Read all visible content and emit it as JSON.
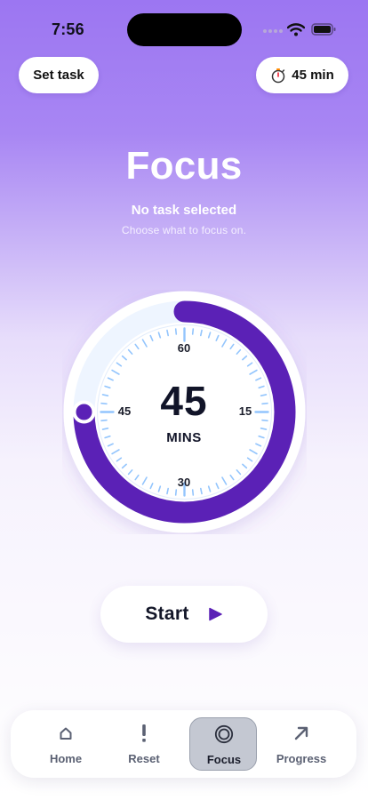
{
  "status_bar": {
    "time": "7:56"
  },
  "header": {
    "set_task_label": "Set task",
    "duration_label": "45 min",
    "duration_icon": "stopwatch-icon"
  },
  "focus": {
    "title": "Focus",
    "task_status": "No task selected",
    "hint": "Choose what to focus on."
  },
  "dial": {
    "value": "45",
    "unit": "MINS",
    "labels": {
      "top": "60",
      "right": "15",
      "bottom": "30",
      "left": "45"
    },
    "fill_fraction": 0.75,
    "ring_color": "#5b21b6",
    "tick_color": "#93c5fd"
  },
  "start_button": {
    "label": "Start",
    "icon": "play-icon",
    "accent": "#5b21b6"
  },
  "tabbar": {
    "items": [
      {
        "label": "Home",
        "icon": "home-icon"
      },
      {
        "label": "Reset",
        "icon": "exclamation-icon"
      },
      {
        "label": "Focus",
        "icon": "target-icon",
        "active": true
      },
      {
        "label": "Progress",
        "icon": "arrow-up-right-icon"
      }
    ]
  }
}
